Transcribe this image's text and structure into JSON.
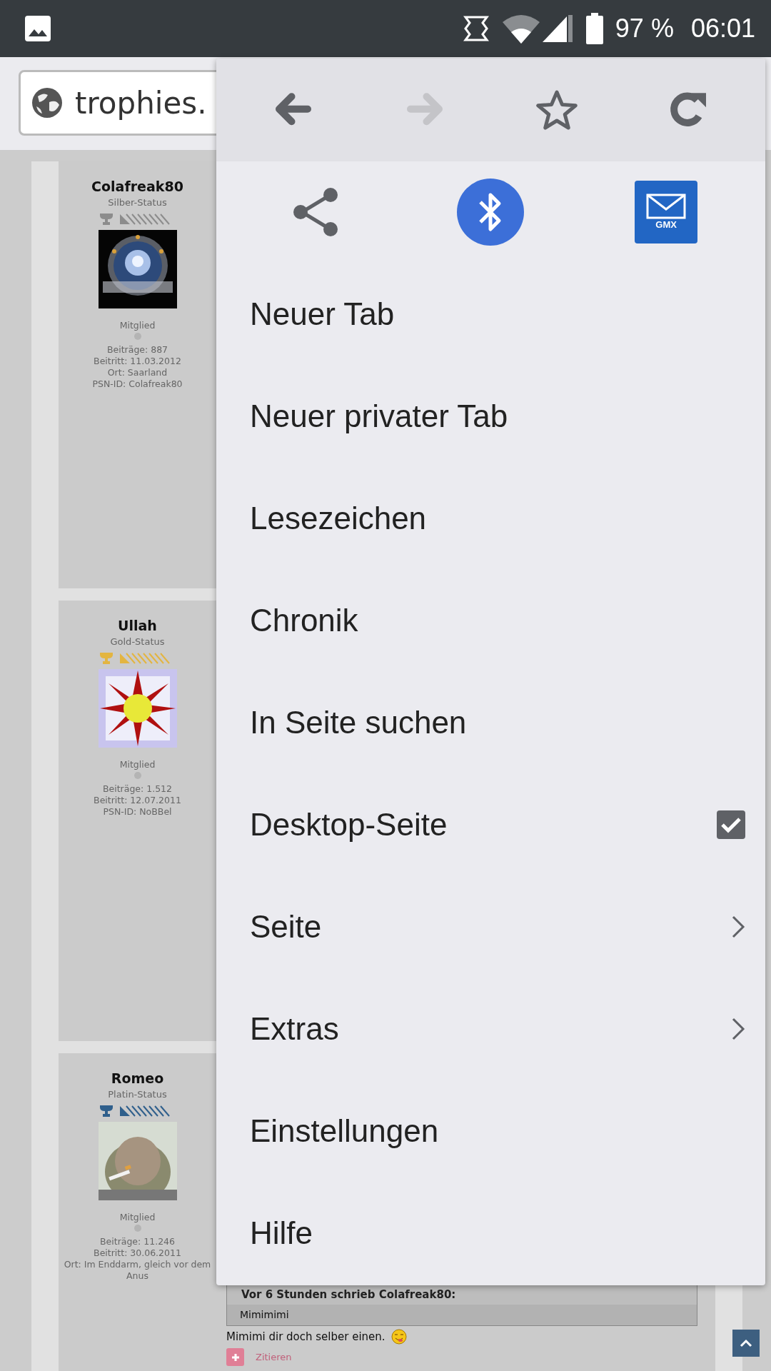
{
  "status_bar": {
    "battery": "97 %",
    "time": "06:01"
  },
  "address_bar": {
    "url": "trophies."
  },
  "posts": [
    {
      "username": "Colafreak80",
      "rank": "Silber-Status",
      "color": "#8c8c8c",
      "avatar": {
        "kind": "picture"
      },
      "role": "Mitglied",
      "stats": [
        "Beiträge: 887",
        "Beitritt: 11.03.2012",
        "Ort: Saarland",
        "PSN-ID: Colafreak80"
      ]
    },
    {
      "username": "Ullah",
      "rank": "Gold-Status",
      "color": "#e3b541",
      "avatar": {
        "kind": "picture"
      },
      "role": "Mitglied",
      "stats": [
        "Beiträge: 1.512",
        "Beitritt: 12.07.2011",
        "PSN-ID: NoBBel"
      ]
    },
    {
      "username": "Romeo",
      "rank": "Platin-Status",
      "color": "#2f5f8c",
      "avatar": {
        "kind": "picture"
      },
      "role": "Mitglied",
      "stats": [
        "Beiträge: 11.246",
        "Beitritt: 30.06.2011",
        "Ort: Im Enddarm, gleich vor dem Anus"
      ]
    }
  ],
  "post_body": {
    "quote_header": "Vor 6 Stunden schrieb Colafreak80:",
    "quote_text": "Mimimimi",
    "reply": "Mimimi dir doch selber einen.",
    "quote_button": "Zitieren"
  },
  "menu": {
    "nav": [
      {
        "kind": "back",
        "disabled": false
      },
      {
        "kind": "forward",
        "disabled": true
      },
      {
        "kind": "bookmark",
        "disabled": false
      },
      {
        "kind": "reload",
        "disabled": false
      }
    ],
    "share": [
      {
        "kind": "share"
      },
      {
        "kind": "bluetooth"
      },
      {
        "kind": "mail",
        "label": "GMX"
      }
    ],
    "items": [
      {
        "label": "Neuer Tab",
        "kind": "plain"
      },
      {
        "label": "Neuer privater Tab",
        "kind": "plain"
      },
      {
        "label": "Lesezeichen",
        "kind": "plain"
      },
      {
        "label": "Chronik",
        "kind": "plain"
      },
      {
        "label": "In Seite suchen",
        "kind": "plain"
      },
      {
        "label": "Desktop-Seite",
        "kind": "checkbox",
        "checked": true
      },
      {
        "label": "Seite",
        "kind": "submenu"
      },
      {
        "label": "Extras",
        "kind": "submenu"
      },
      {
        "label": "Einstellungen",
        "kind": "plain"
      },
      {
        "label": "Hilfe",
        "kind": "plain"
      }
    ]
  }
}
